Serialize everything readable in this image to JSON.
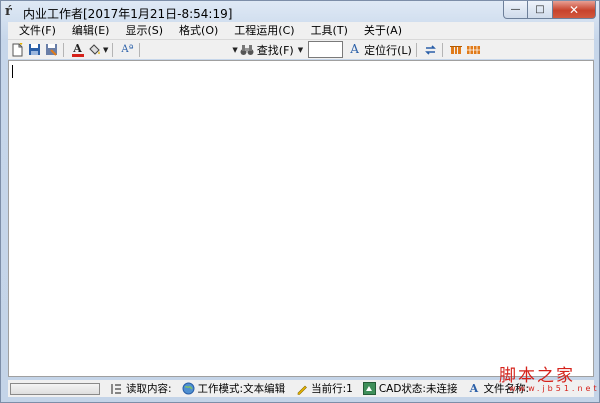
{
  "window": {
    "title": "内业工作者[2017年1月21日-8:54:19]",
    "app_icon": "ŕ",
    "close_glyph": "✕",
    "max_glyph": "□",
    "min_glyph": "—"
  },
  "menu": {
    "items": [
      "文件(F)",
      "编辑(E)",
      "显示(S)",
      "格式(O)",
      "工程运用(C)",
      "工具(T)",
      "关于(A)"
    ]
  },
  "toolbar": {
    "find_label": "查找(F)",
    "goto_label": "定位行(L)",
    "goto_value": "",
    "font_size_glyph": "Aª",
    "font_color_glyph": "A",
    "goto_glyph": "A"
  },
  "status": {
    "read_content": "读取内容:",
    "work_mode": "工作模式:文本编辑",
    "current_line": "当前行:1",
    "cad_status": "CAD状态:未连接",
    "file_name": "文件名称:",
    "file_glyph": "A"
  },
  "watermark": {
    "main": "脚本之家",
    "sub": "www.jb51.net"
  },
  "colors": {
    "accent_red": "#d5221b",
    "toolbar_orange": "#e07b1a",
    "icon_blue": "#2a5fa8"
  },
  "icons": [
    "new-file-icon",
    "save-icon",
    "save-as-icon",
    "font-color-icon",
    "fill-icon",
    "font-size-icon",
    "binoculars-icon",
    "goto-line-icon",
    "swap-icon",
    "bar-chart-icon",
    "grid-icon"
  ]
}
